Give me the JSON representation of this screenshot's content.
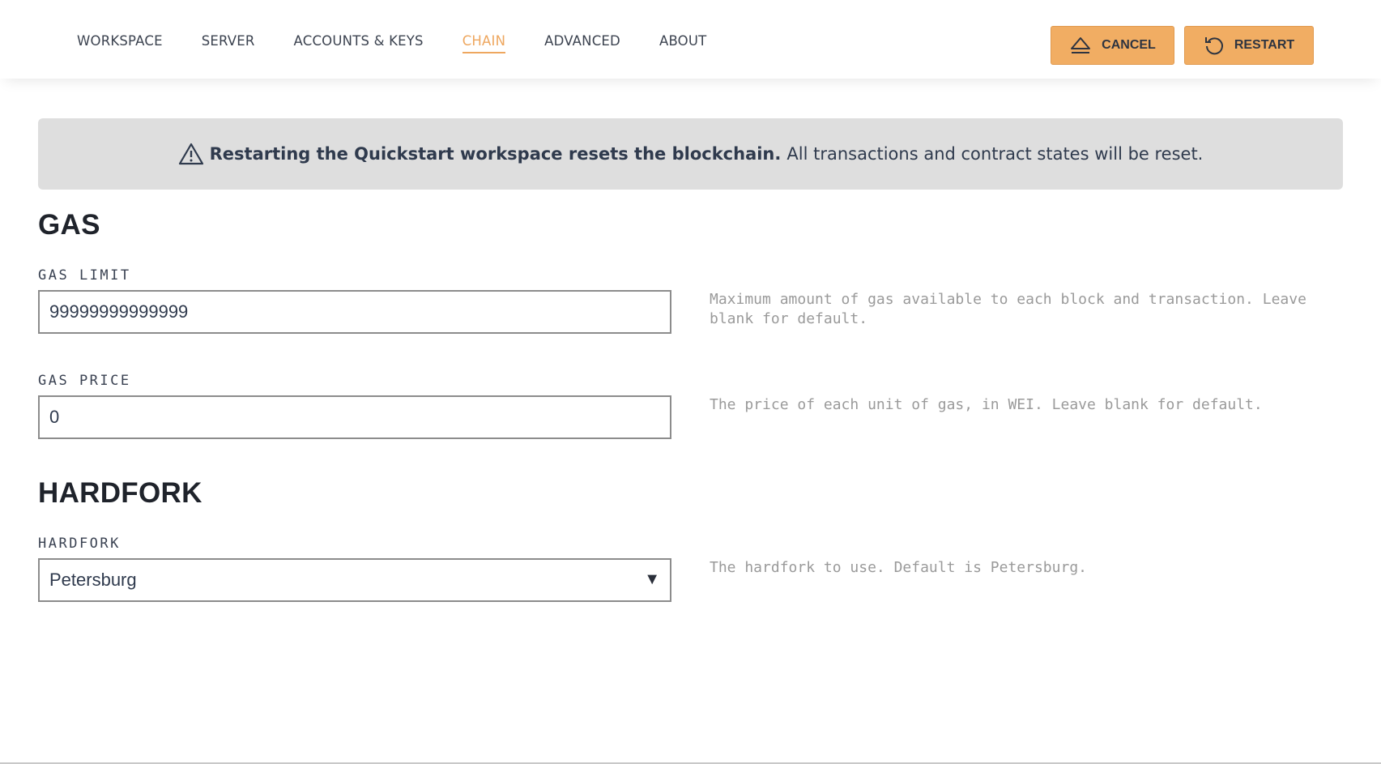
{
  "nav": {
    "tabs": [
      {
        "label": "WORKSPACE"
      },
      {
        "label": "SERVER"
      },
      {
        "label": "ACCOUNTS & KEYS"
      },
      {
        "label": "CHAIN",
        "active": true
      },
      {
        "label": "ADVANCED"
      },
      {
        "label": "ABOUT"
      }
    ],
    "cancel_label": "CANCEL",
    "restart_label": "RESTART"
  },
  "banner": {
    "bold": "Restarting the Quickstart workspace resets the blockchain.",
    "rest": "All transactions and contract states will be reset."
  },
  "gas": {
    "title": "GAS",
    "limit": {
      "label": "GAS LIMIT",
      "value": "99999999999999",
      "help": "Maximum amount of gas available to each block and transaction. Leave blank for default."
    },
    "price": {
      "label": "GAS PRICE",
      "value": "0",
      "help": "The price of each unit of gas, in WEI. Leave blank for default."
    }
  },
  "hardfork": {
    "title": "HARDFORK",
    "label": "HARDFORK",
    "value": "Petersburg",
    "help": "The hardfork to use. Default is Petersburg."
  },
  "colors": {
    "accent": "#eea75f",
    "button": "#f1ad63",
    "banner_bg": "#dedede"
  }
}
